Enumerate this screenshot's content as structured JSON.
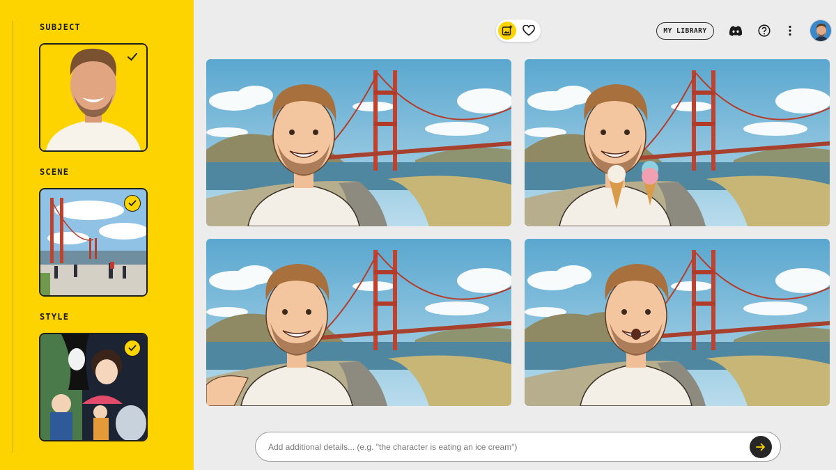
{
  "sidebar": {
    "sections": [
      {
        "label": "SUBJECT",
        "selected": true,
        "image": "subject-photo"
      },
      {
        "label": "SCENE",
        "selected": true,
        "image": "golden-gate-photo"
      },
      {
        "label": "STYLE",
        "selected": true,
        "image": "anime-style-poster"
      }
    ]
  },
  "header": {
    "mode_icons": [
      "image-add-icon",
      "heart-icon"
    ],
    "library_label": "MY LIBRARY",
    "icons": [
      "discord-icon",
      "help-icon",
      "more-icon",
      "avatar"
    ]
  },
  "results": [
    {
      "image": "result-smiling"
    },
    {
      "image": "result-ice-cream"
    },
    {
      "image": "result-selfie"
    },
    {
      "image": "result-surprised"
    }
  ],
  "prompt": {
    "placeholder": "Add additional details... (e.g. \"the character is eating an ice cream\")",
    "value": ""
  },
  "colors": {
    "accent": "#fdd400",
    "background": "#ececec",
    "dark": "#262626"
  }
}
